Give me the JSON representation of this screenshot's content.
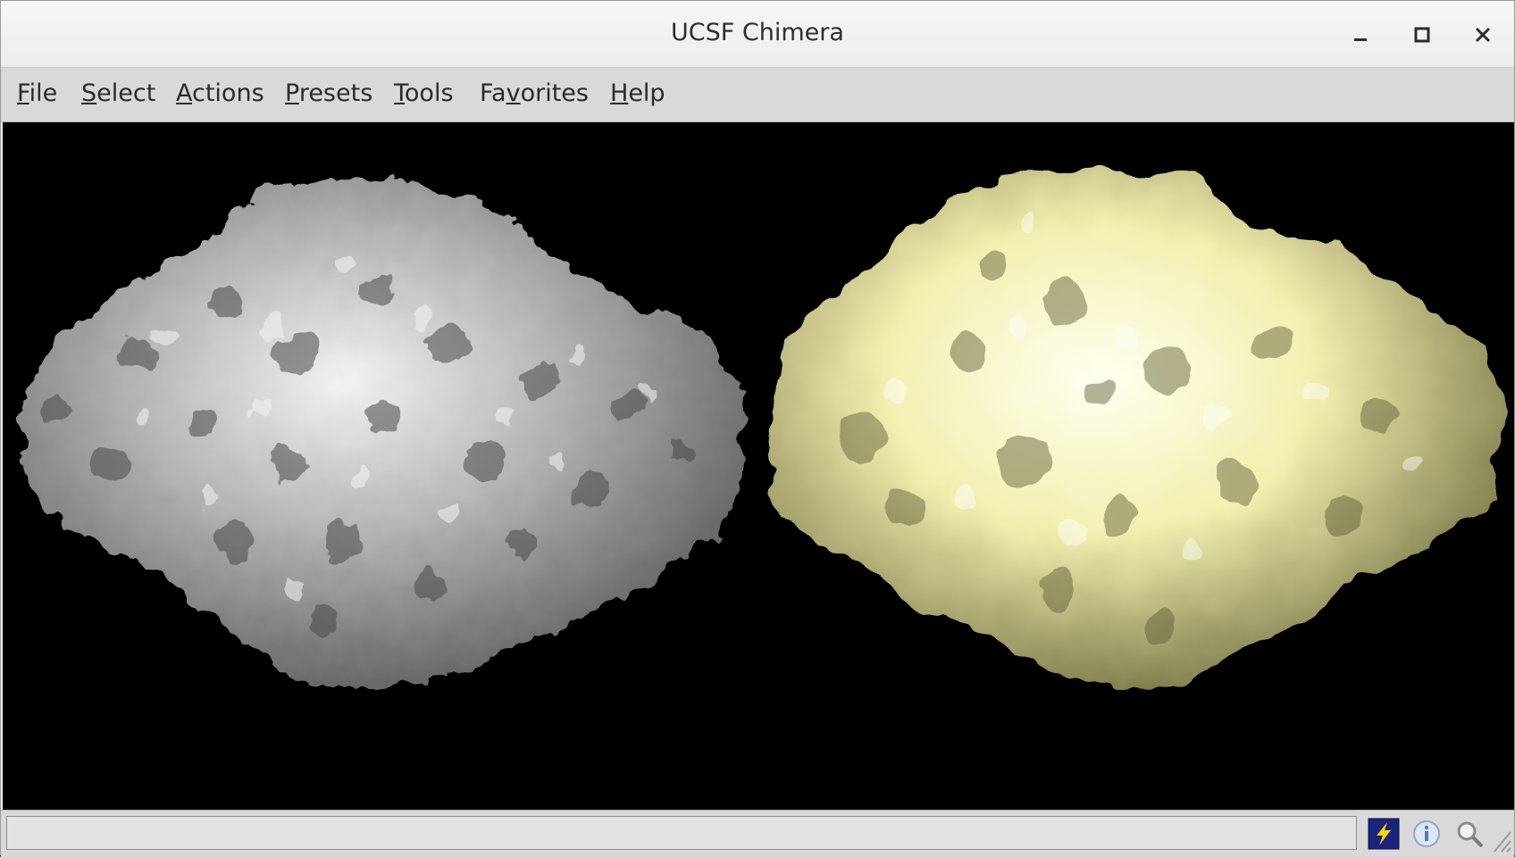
{
  "window": {
    "title": "UCSF Chimera"
  },
  "menubar": {
    "items": [
      {
        "label": "File",
        "mnemonic_index": 0
      },
      {
        "label": "Select",
        "mnemonic_index": 0
      },
      {
        "label": "Actions",
        "mnemonic_index": 0
      },
      {
        "label": "Presets",
        "mnemonic_index": 0
      },
      {
        "label": "Tools",
        "mnemonic_index": 0
      },
      {
        "label": "Favorites",
        "mnemonic_index": 2
      },
      {
        "label": "Help",
        "mnemonic_index": 0
      }
    ]
  },
  "viewport": {
    "background": "#000000",
    "models": [
      {
        "kind": "density-surface",
        "color": "#b4b4b4"
      },
      {
        "kind": "density-surface",
        "color": "#f2f0b0"
      }
    ]
  },
  "statusbar": {
    "message": "",
    "icons": [
      "command-line-icon",
      "info-icon",
      "search-icon"
    ]
  },
  "colors": {
    "menubar": "#d9d9d9",
    "titlebar": "#ececec",
    "accent_icon_bg": "#1a237e",
    "accent_bolt": "#ffd700"
  }
}
